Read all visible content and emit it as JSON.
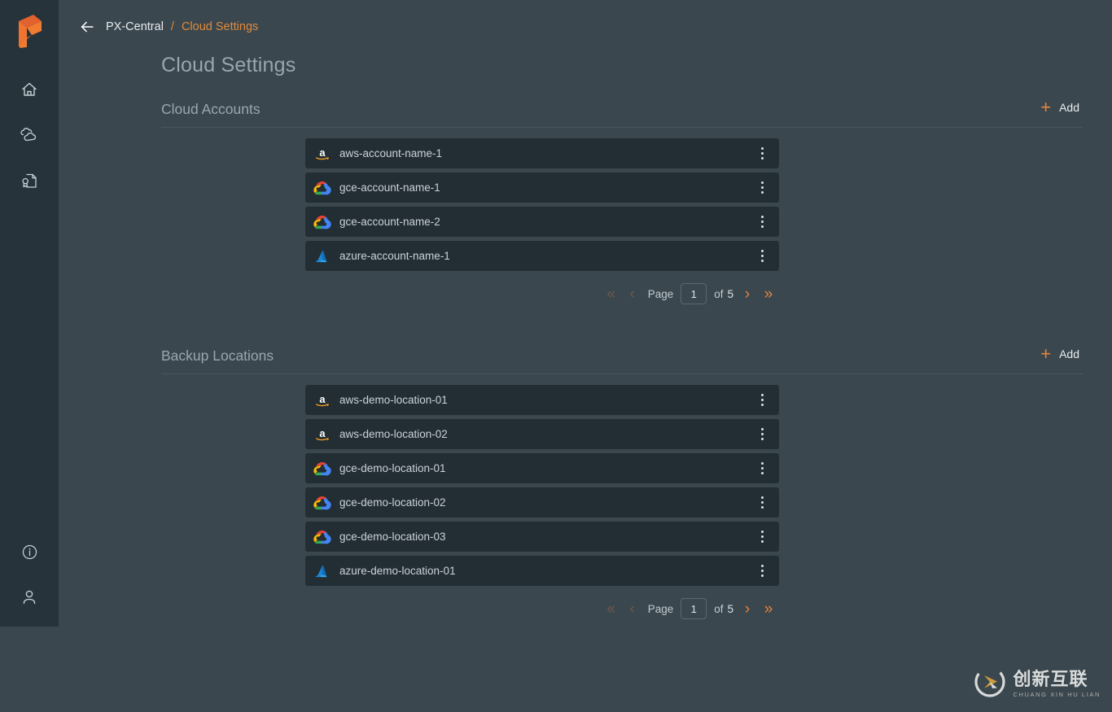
{
  "colors": {
    "accent": "#e8843c",
    "page_bg": "#3a474e",
    "sidebar_bg": "#26333a",
    "row_bg": "#232e34",
    "text_muted": "#9aa6ad"
  },
  "sidebar": {
    "logo_name": "portworx-logo",
    "top_items": [
      {
        "name": "sidebar-item-home",
        "icon": "home-icon"
      },
      {
        "name": "sidebar-item-clouds",
        "icon": "clouds-icon"
      },
      {
        "name": "sidebar-item-license",
        "icon": "license-document-icon"
      }
    ],
    "bottom_items": [
      {
        "name": "sidebar-item-info",
        "icon": "info-circle-icon"
      },
      {
        "name": "sidebar-item-account",
        "icon": "user-icon"
      }
    ]
  },
  "topbar": {
    "back_icon": "back-arrow-icon",
    "breadcrumb": {
      "root": "PX-Central",
      "separator": "/",
      "current": "Cloud Settings"
    }
  },
  "page": {
    "title": "Cloud Settings"
  },
  "sections": [
    {
      "title": "Cloud Accounts",
      "add_label": "Add",
      "rows": [
        {
          "provider": "aws",
          "icon": "aws-icon",
          "label": "aws-account-name-1"
        },
        {
          "provider": "gce",
          "icon": "gcp-icon",
          "label": "gce-account-name-1"
        },
        {
          "provider": "gce",
          "icon": "gcp-icon",
          "label": "gce-account-name-2"
        },
        {
          "provider": "azure",
          "icon": "azure-icon",
          "label": "azure-account-name-1"
        }
      ],
      "pagination": {
        "first_icon": "first-page-icon",
        "prev_icon": "prev-page-icon",
        "page_label": "Page",
        "page_value": "1",
        "of_label": "of",
        "total_pages": "5",
        "next_icon": "next-page-icon",
        "last_icon": "last-page-icon"
      }
    },
    {
      "title": "Backup Locations",
      "add_label": "Add",
      "rows": [
        {
          "provider": "aws",
          "icon": "aws-icon",
          "label": "aws-demo-location-01"
        },
        {
          "provider": "aws",
          "icon": "aws-icon",
          "label": "aws-demo-location-02"
        },
        {
          "provider": "gce",
          "icon": "gcp-icon",
          "label": "gce-demo-location-01"
        },
        {
          "provider": "gce",
          "icon": "gcp-icon",
          "label": "gce-demo-location-02"
        },
        {
          "provider": "gce",
          "icon": "gcp-icon",
          "label": "gce-demo-location-03"
        },
        {
          "provider": "azure",
          "icon": "azure-icon",
          "label": "azure-demo-location-01"
        }
      ],
      "pagination": {
        "first_icon": "first-page-icon",
        "prev_icon": "prev-page-icon",
        "page_label": "Page",
        "page_value": "1",
        "of_label": "of",
        "total_pages": "5",
        "next_icon": "next-page-icon",
        "last_icon": "last-page-icon"
      }
    }
  ],
  "watermark": {
    "chinese": "创新互联",
    "pinyin": "CHUANG XIN HU LIAN"
  }
}
